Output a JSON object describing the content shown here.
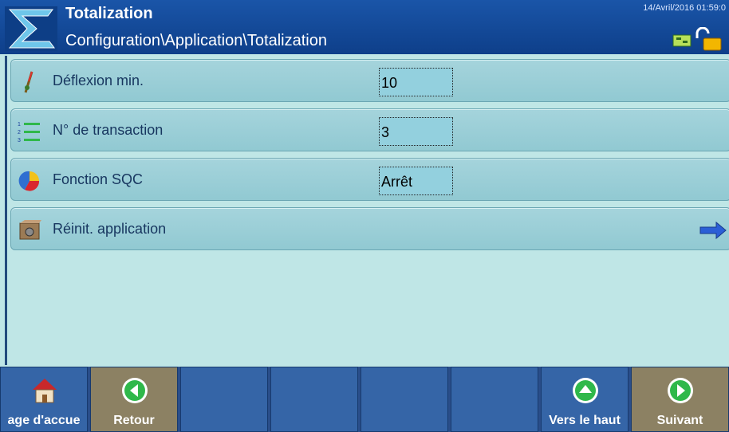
{
  "header": {
    "title": "Totalization",
    "breadcrumb": "Configuration\\Application\\Totalization",
    "datetime": "14/Avril/2016 01:59:0"
  },
  "rows": [
    {
      "label": "Déflexion min.",
      "value": "10",
      "icon": "deflection-icon"
    },
    {
      "label": "N° de transaction",
      "value": "3",
      "icon": "numbered-list-icon"
    },
    {
      "label": "Fonction SQC",
      "value": "Arrêt",
      "icon": "pie-chart-icon"
    },
    {
      "label": "Réinit. application",
      "icon": "reset-box-icon",
      "action_icon": "arrow-right-icon"
    }
  ],
  "softkeys": [
    {
      "label": "age d'accue",
      "icon": "home-icon"
    },
    {
      "label": "Retour",
      "icon": "back-arrow-icon"
    },
    {
      "label": ""
    },
    {
      "label": ""
    },
    {
      "label": ""
    },
    {
      "label": ""
    },
    {
      "label": "Vers le haut",
      "icon": "up-arrow-icon"
    },
    {
      "label": "Suivant",
      "icon": "next-arrow-icon"
    }
  ],
  "colors": {
    "header_bg": "#1a55a8",
    "row_bg": "#a5d4dc",
    "field_bg": "#93d0de",
    "softkey_blue": "#3565a7",
    "softkey_tan": "#8c8163",
    "icon_green": "#2fb84a"
  }
}
